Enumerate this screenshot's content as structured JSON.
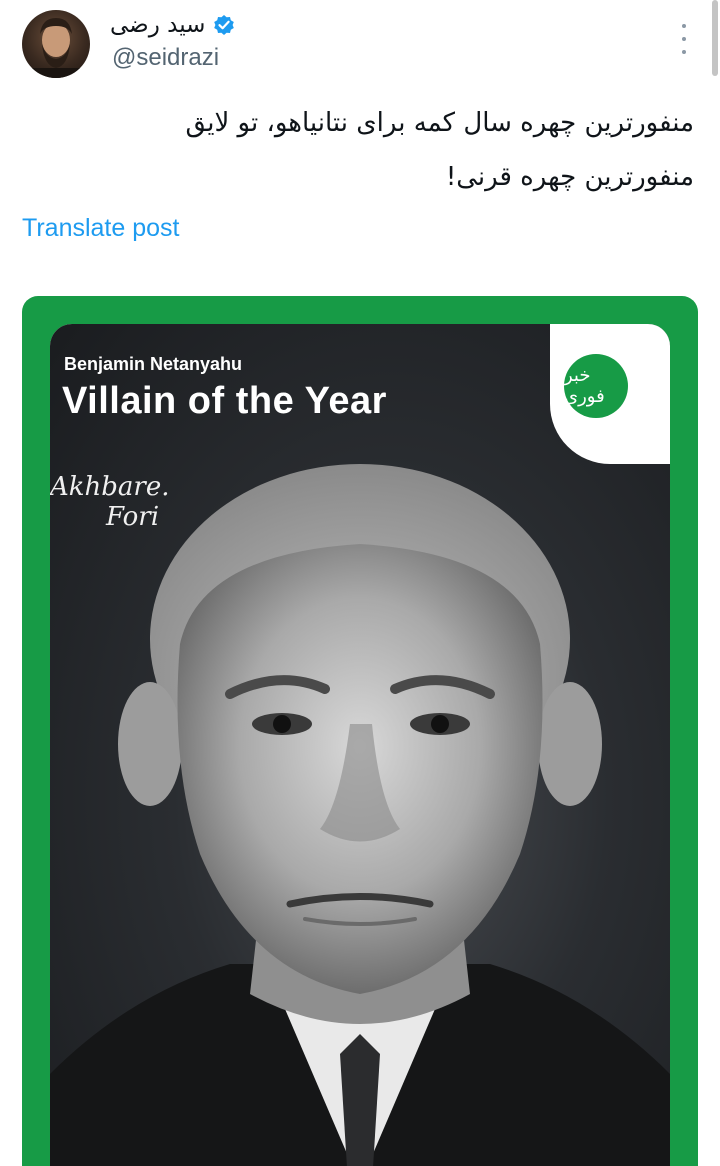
{
  "author": {
    "display_name": "سید رضی",
    "handle": "@seidrazi",
    "verified": true,
    "verified_color": "#1d9bf0",
    "avatar_icon": "user-avatar"
  },
  "post": {
    "text_line1": "منفورترین چهره سال کمه برای نتانیاهو، تو لایق",
    "text_line2": "منفورترین چهره قرنی!",
    "translate_label": "Translate post",
    "more_icon": "more-options-icon"
  },
  "media": {
    "frame_color": "#179b46",
    "subtitle": "Benjamin Netanyahu",
    "title": "Villain of the Year",
    "watermark_line1": "Akhbare.",
    "watermark_line2": "Fori",
    "logo_text": "خبر فوری",
    "photo_description_icon": "portrait-photo"
  }
}
